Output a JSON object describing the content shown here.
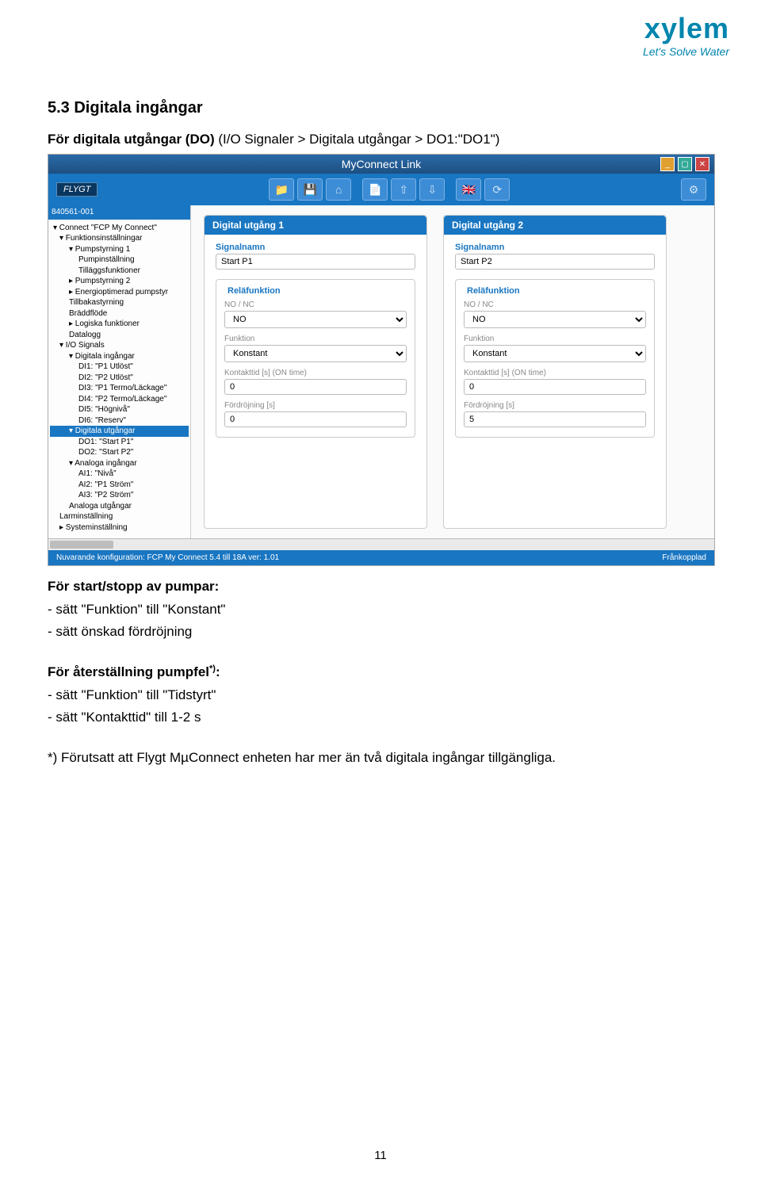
{
  "logo": {
    "name": "xylem",
    "tagline": "Let's Solve Water"
  },
  "section_title": "5.3 Digitala ingångar",
  "subtitle_prefix": "För digitala utgångar (DO)",
  "subtitle_path": " (I/O Signaler > Digitala utgångar > DO1:\"DO1\")",
  "app": {
    "title": "MyConnect Link",
    "brand": "FLYGT",
    "device_id": "840561-001",
    "footer_left": "Nuvarande konfiguration:  FCP My Connect 5.4 till 18A ver: 1.01",
    "footer_right": "Frånkopplad",
    "tree": [
      {
        "lvl": 0,
        "txt": "Connect \"FCP My Connect\"",
        "exp": "▾"
      },
      {
        "lvl": 1,
        "txt": "Funktionsinställningar",
        "exp": "▾"
      },
      {
        "lvl": 2,
        "txt": "Pumpstyrning 1",
        "exp": "▾"
      },
      {
        "lvl": 3,
        "txt": "Pumpinställning"
      },
      {
        "lvl": 3,
        "txt": "Tilläggsfunktioner"
      },
      {
        "lvl": 2,
        "txt": "Pumpstyrning 2",
        "exp": "▸"
      },
      {
        "lvl": 2,
        "txt": "Energioptimerad pumpstyr",
        "exp": "▸"
      },
      {
        "lvl": 2,
        "txt": "Tillbakastyrning"
      },
      {
        "lvl": 2,
        "txt": "Bräddflöde"
      },
      {
        "lvl": 2,
        "txt": "Logiska funktioner",
        "exp": "▸"
      },
      {
        "lvl": 2,
        "txt": "Datalogg"
      },
      {
        "lvl": 1,
        "txt": "I/O Signals",
        "exp": "▾"
      },
      {
        "lvl": 2,
        "txt": "Digitala ingångar",
        "exp": "▾"
      },
      {
        "lvl": 3,
        "txt": "DI1: \"P1 Utlöst\""
      },
      {
        "lvl": 3,
        "txt": "DI2: \"P2 Utlöst\""
      },
      {
        "lvl": 3,
        "txt": "DI3: \"P1 Termo/Läckage\""
      },
      {
        "lvl": 3,
        "txt": "DI4: \"P2 Termo/Läckage\""
      },
      {
        "lvl": 3,
        "txt": "DI5: \"Högnivå\""
      },
      {
        "lvl": 3,
        "txt": "DI6: \"Reserv\""
      },
      {
        "lvl": 2,
        "txt": "Digitala utgångar",
        "exp": "▾",
        "sel": true
      },
      {
        "lvl": 3,
        "txt": "DO1: \"Start P1\""
      },
      {
        "lvl": 3,
        "txt": "DO2: \"Start P2\""
      },
      {
        "lvl": 2,
        "txt": "Analoga ingångar",
        "exp": "▾"
      },
      {
        "lvl": 3,
        "txt": "AI1: \"Nivå\""
      },
      {
        "lvl": 3,
        "txt": "AI2: \"P1 Ström\""
      },
      {
        "lvl": 3,
        "txt": "AI3: \"P2 Ström\""
      },
      {
        "lvl": 2,
        "txt": "Analoga utgångar"
      },
      {
        "lvl": 1,
        "txt": "Larminställning"
      },
      {
        "lvl": 1,
        "txt": "Systeminställning",
        "exp": "▸"
      }
    ],
    "panels": [
      {
        "header": "Digital utgång 1",
        "signal_label": "Signalnamn",
        "signal_value": "Start P1",
        "relay_legend": "Reläfunktion",
        "fields": [
          {
            "label": "NO / NC",
            "value": "NO",
            "type": "select"
          },
          {
            "label": "Funktion",
            "value": "Konstant",
            "type": "select"
          },
          {
            "label": "Kontakttid [s] (ON time)",
            "value": "0",
            "type": "text"
          },
          {
            "label": "Fördröjning [s]",
            "value": "0",
            "type": "text"
          }
        ]
      },
      {
        "header": "Digital utgång 2",
        "signal_label": "Signalnamn",
        "signal_value": "Start P2",
        "relay_legend": "Reläfunktion",
        "fields": [
          {
            "label": "NO / NC",
            "value": "NO",
            "type": "select"
          },
          {
            "label": "Funktion",
            "value": "Konstant",
            "type": "select"
          },
          {
            "label": "Kontakttid [s] (ON time)",
            "value": "0",
            "type": "text"
          },
          {
            "label": "Fördröjning [s]",
            "value": "5",
            "type": "text"
          }
        ]
      }
    ]
  },
  "text_below": {
    "h1": "För start/stopp av pumpar:",
    "l1": "- sätt \"Funktion\" till \"Konstant\"",
    "l2": "- sätt önskad fördröjning",
    "h2_pre": "För återställning pumpfel",
    "h2_sup": "*)",
    "h2_post": ":",
    "l3": "- sätt \"Funktion\" till \"Tidstyrt\"",
    "l4": "- sätt \"Kontakttid\" till 1-2 s",
    "footnote": "*) Förutsatt att Flygt MµConnect enheten har mer än två digitala ingångar tillgängliga."
  },
  "page_number": "11"
}
